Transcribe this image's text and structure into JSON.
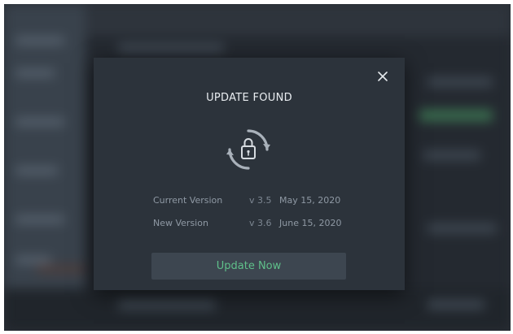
{
  "dialog": {
    "title": "UPDATE FOUND",
    "rows": [
      {
        "label": "Current Version",
        "version": "v 3.5",
        "date": "May 15, 2020"
      },
      {
        "label": "New Version",
        "version": "v 3.6",
        "date": "June 15, 2020"
      }
    ],
    "update_button_label": "Update Now"
  },
  "icons": {
    "close": "close-icon",
    "update": "padlock-refresh-icon"
  },
  "colors": {
    "accent": "#5fc08a",
    "dialog_background": "#2c333b",
    "button_background": "#3d4650"
  }
}
